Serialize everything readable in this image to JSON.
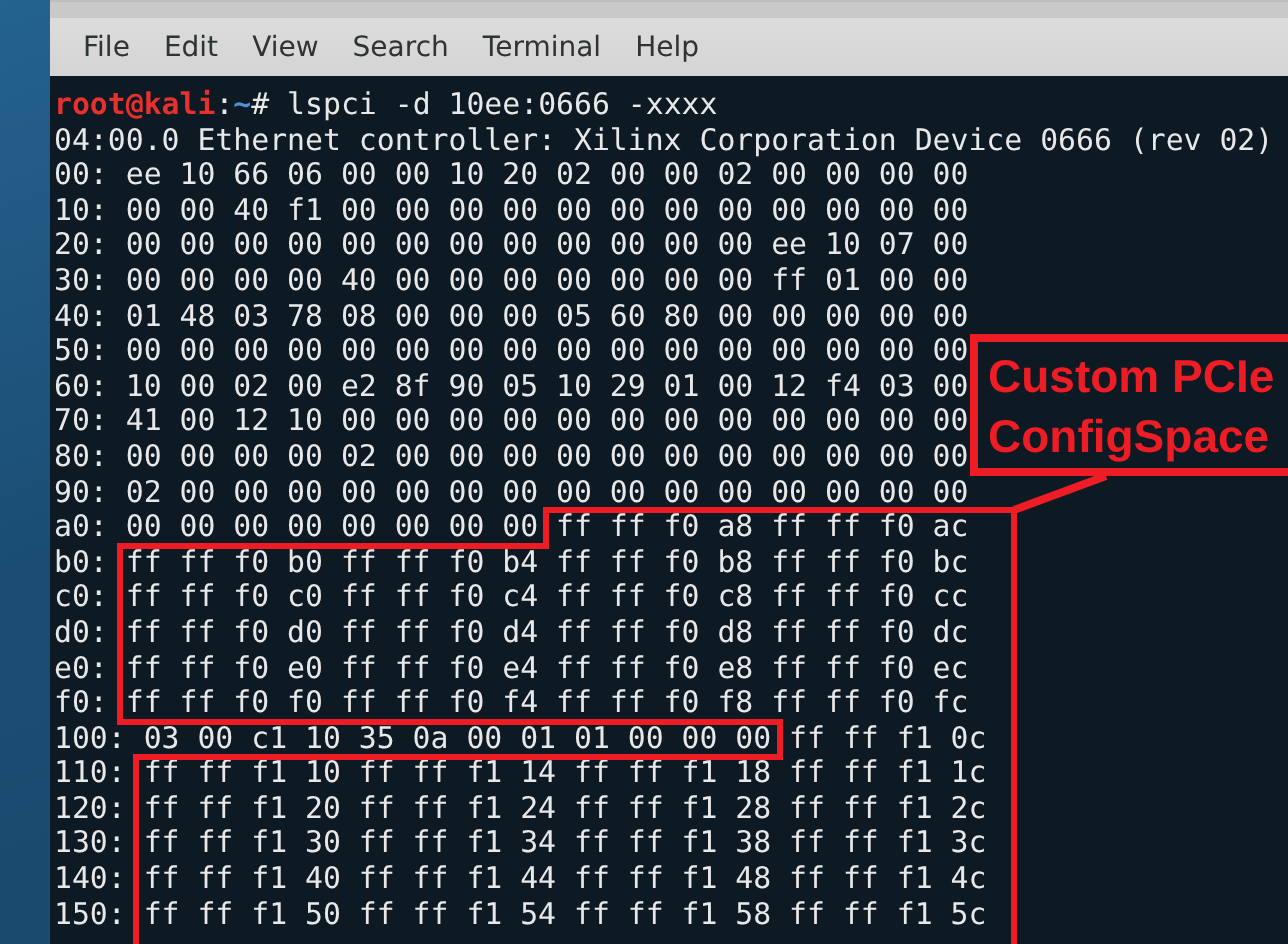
{
  "menu": [
    "File",
    "Edit",
    "View",
    "Search",
    "Terminal",
    "Help"
  ],
  "prompt": {
    "user_host": "root@kali",
    "separator": ":",
    "path": "~",
    "symbol": "#",
    "command": " lspci -d 10ee:0666 -xxxx"
  },
  "output": [
    "04:00.0 Ethernet controller: Xilinx Corporation Device 0666 (rev 02)",
    "00: ee 10 66 06 00 00 10 20 02 00 00 02 00 00 00 00",
    "10: 00 00 40 f1 00 00 00 00 00 00 00 00 00 00 00 00",
    "20: 00 00 00 00 00 00 00 00 00 00 00 00 ee 10 07 00",
    "30: 00 00 00 00 40 00 00 00 00 00 00 00 ff 01 00 00",
    "40: 01 48 03 78 08 00 00 00 05 60 80 00 00 00 00 00",
    "50: 00 00 00 00 00 00 00 00 00 00 00 00 00 00 00 00",
    "60: 10 00 02 00 e2 8f 90 05 10 29 01 00 12 f4 03 00",
    "70: 41 00 12 10 00 00 00 00 00 00 00 00 00 00 00 00",
    "80: 00 00 00 00 02 00 00 00 00 00 00 00 00 00 00 00",
    "90: 02 00 00 00 00 00 00 00 00 00 00 00 00 00 00 00",
    "a0: 00 00 00 00 00 00 00 00 ff ff f0 a8 ff ff f0 ac",
    "b0: ff ff f0 b0 ff ff f0 b4 ff ff f0 b8 ff ff f0 bc",
    "c0: ff ff f0 c0 ff ff f0 c4 ff ff f0 c8 ff ff f0 cc",
    "d0: ff ff f0 d0 ff ff f0 d4 ff ff f0 d8 ff ff f0 dc",
    "e0: ff ff f0 e0 ff ff f0 e4 ff ff f0 e8 ff ff f0 ec",
    "f0: ff ff f0 f0 ff ff f0 f4 ff ff f0 f8 ff ff f0 fc",
    "100: 03 00 c1 10 35 0a 00 01 01 00 00 00 ff ff f1 0c",
    "110: ff ff f1 10 ff ff f1 14 ff ff f1 18 ff ff f1 1c",
    "120: ff ff f1 20 ff ff f1 24 ff ff f1 28 ff ff f1 2c",
    "130: ff ff f1 30 ff ff f1 34 ff ff f1 38 ff ff f1 3c",
    "140: ff ff f1 40 ff ff f1 44 ff ff f1 48 ff ff f1 4c",
    "150: ff ff f1 50 ff ff f1 54 ff ff f1 58 ff ff f1 5c"
  ],
  "annotation": {
    "label_lines": [
      "Custom PCIe",
      "ConfigSpace"
    ]
  }
}
